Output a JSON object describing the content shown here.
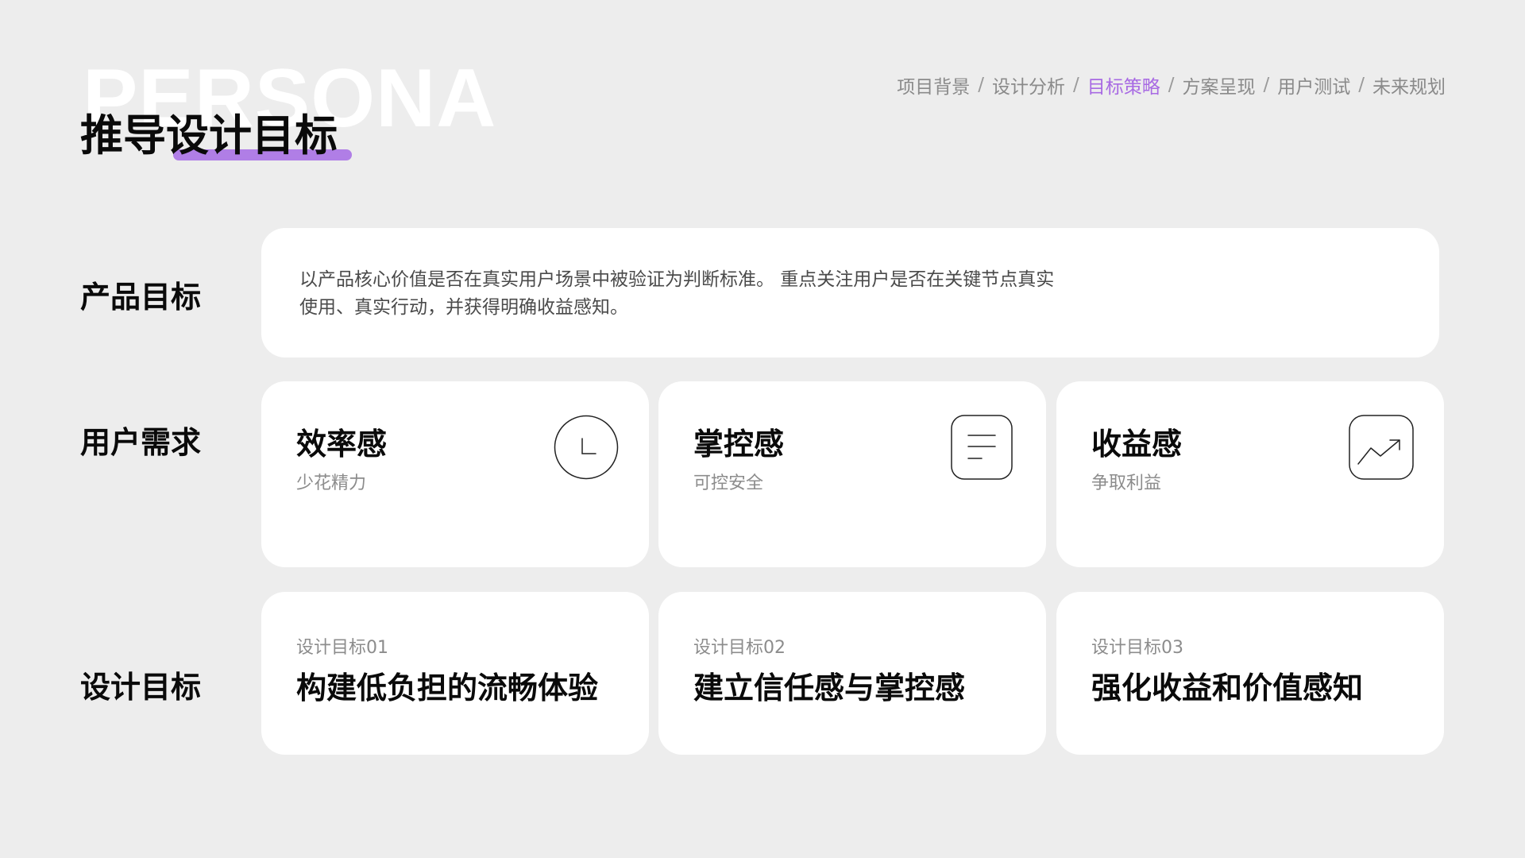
{
  "watermark": "PERSONA",
  "title": "推导设计目标",
  "breadcrumb": [
    {
      "label": "项目背景",
      "active": false
    },
    {
      "label": "设计分析",
      "active": false
    },
    {
      "label": "目标策略",
      "active": true
    },
    {
      "label": "方案呈现",
      "active": false
    },
    {
      "label": "用户测试",
      "active": false
    },
    {
      "label": "未来规划",
      "active": false
    }
  ],
  "breadcrumb_separator": "/",
  "colors": {
    "accent": "#a86ae3",
    "underline": "#b07ee6",
    "background": "#ededed",
    "card": "#ffffff"
  },
  "rows": {
    "product_label": "产品目标",
    "needs_label": "用户需求",
    "goals_label": "设计目标"
  },
  "product": {
    "line1": "以产品核心价值是否在真实用户场景中被验证为判断标准。 重点关注用户是否在关键节点真实",
    "line2": "使用、真实行动，并获得明确收益感知。"
  },
  "needs": [
    {
      "title": "效率感",
      "subtitle": "少花精力",
      "icon": "clock-icon"
    },
    {
      "title": "掌控感",
      "subtitle": "可控安全",
      "icon": "document-lines-icon"
    },
    {
      "title": "收益感",
      "subtitle": "争取利益",
      "icon": "trend-up-icon"
    }
  ],
  "goals": [
    {
      "number": "设计目标01",
      "title": "构建低负担的流畅体验"
    },
    {
      "number": "设计目标02",
      "title": "建立信任感与掌控感"
    },
    {
      "number": "设计目标03",
      "title": "强化收益和价值感知"
    }
  ]
}
